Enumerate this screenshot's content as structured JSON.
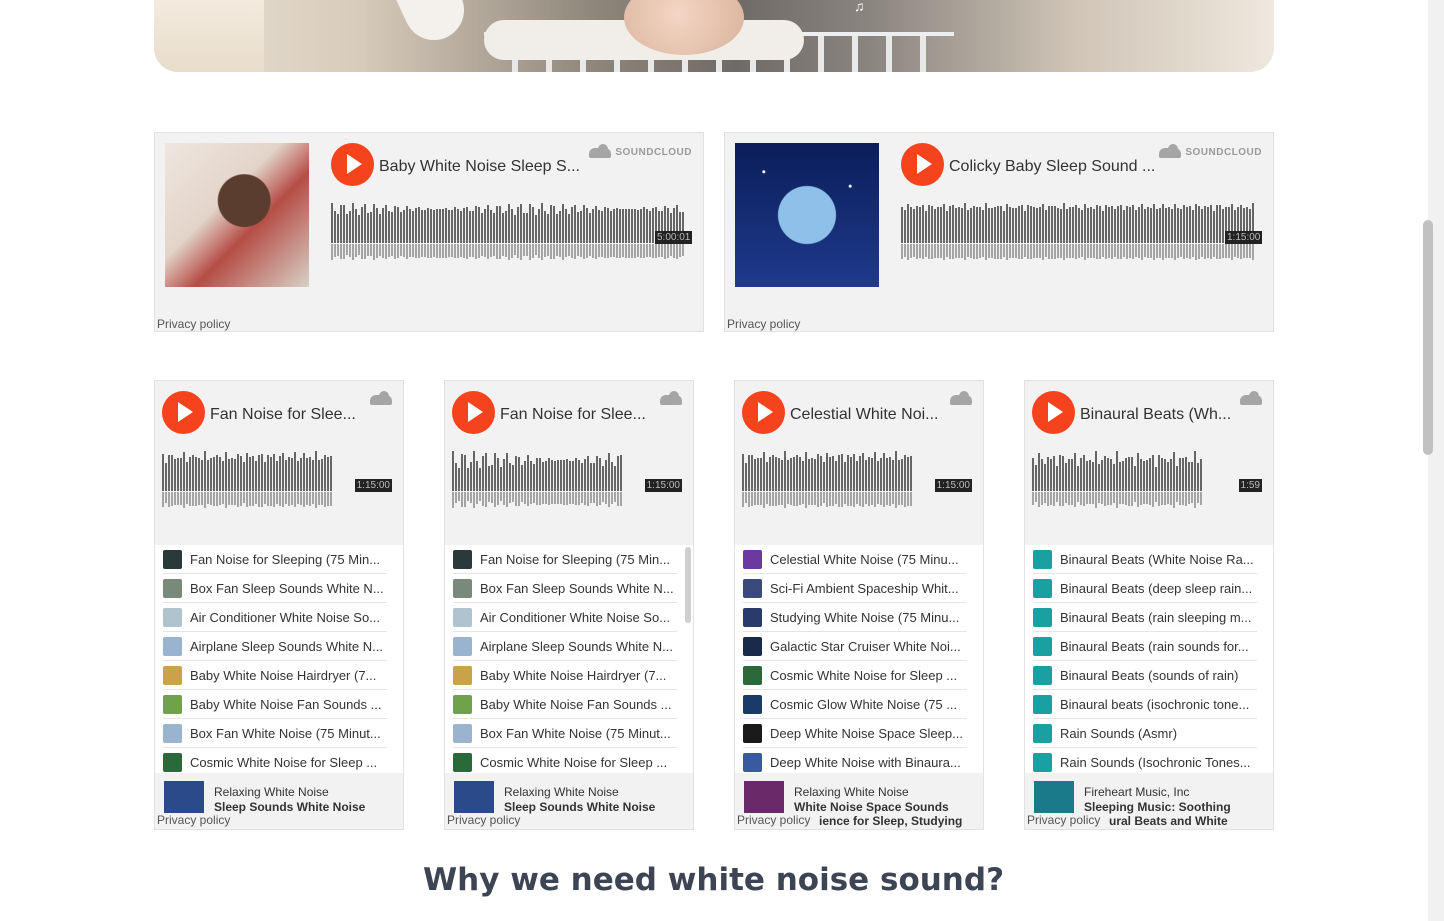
{
  "big_players": [
    {
      "title": "Baby White Noise Sleep S...",
      "duration": "5:00:01",
      "provider": "SOUNDCLOUD",
      "privacy": "Privacy policy"
    },
    {
      "title": "Colicky Baby Sleep Sound ...",
      "duration": "1:15:00",
      "provider": "SOUNDCLOUD",
      "privacy": "Privacy policy"
    }
  ],
  "playlists": [
    {
      "title": "Fan Noise for Slee...",
      "duration": "1:15:00",
      "tracks": [
        "Fan Noise for Sleeping (75 Min...",
        "Box Fan Sleep Sounds White N...",
        "Air Conditioner White Noise So...",
        "Airplane Sleep Sounds White N...",
        "Baby White Noise Hairdryer (7...",
        "Baby White Noise Fan Sounds ...",
        "Box Fan White Noise (75 Minut...",
        "Cosmic White Noise for Sleep ..."
      ],
      "footer_artist": "Relaxing White Noise",
      "footer_title": "Sleep Sounds White Noise",
      "privacy": "Privacy policy"
    },
    {
      "title": "Fan Noise for Slee...",
      "duration": "1:15:00",
      "tracks": [
        "Fan Noise for Sleeping (75 Min...",
        "Box Fan Sleep Sounds White N...",
        "Air Conditioner White Noise So...",
        "Airplane Sleep Sounds White N...",
        "Baby White Noise Hairdryer (7...",
        "Baby White Noise Fan Sounds ...",
        "Box Fan White Noise (75 Minut...",
        "Cosmic White Noise for Sleep ..."
      ],
      "footer_artist": "Relaxing White Noise",
      "footer_title": "Sleep Sounds White Noise",
      "privacy": "Privacy policy"
    },
    {
      "title": "Celestial White Noi...",
      "duration": "1:15:00",
      "tracks": [
        "Celestial White Noise (75 Minu...",
        "Sci-Fi Ambient Spaceship Whit...",
        "Studying White Noise (75 Minu...",
        "Galactic Star Cruiser White Noi...",
        "Cosmic White Noise for Sleep ...",
        "Cosmic Glow White Noise (75 ...",
        "Deep White Noise Space Sleep...",
        "Deep White Noise with Binaura..."
      ],
      "footer_artist": "Relaxing White Noise",
      "footer_title": "White Noise Space Sounds",
      "footer_title2": "ience for Sleep, Studying",
      "privacy": "Privacy policy"
    },
    {
      "title": "Binaural Beats (Wh...",
      "duration": "1:59",
      "tracks": [
        "Binaural Beats (White Noise Ra...",
        "Binaural Beats (deep sleep rain...",
        "Binaural Beats (rain sleeping m...",
        "Binaural Beats (rain sounds for...",
        "Binaural Beats (sounds of rain)",
        "Binaural beats (isochronic tone...",
        "Rain Sounds (Asmr)",
        "Rain Sounds (Isochronic Tones..."
      ],
      "footer_artist": "Fireheart Music, Inc",
      "footer_title": "Sleeping Music: Soothing",
      "footer_title2": "ural Beats and White",
      "privacy": "Privacy policy"
    }
  ],
  "section_heading": "Why we need white noise sound?",
  "colors": {
    "play": "#f5431d",
    "heading": "#3d4555",
    "card": "#f2f2f2"
  }
}
